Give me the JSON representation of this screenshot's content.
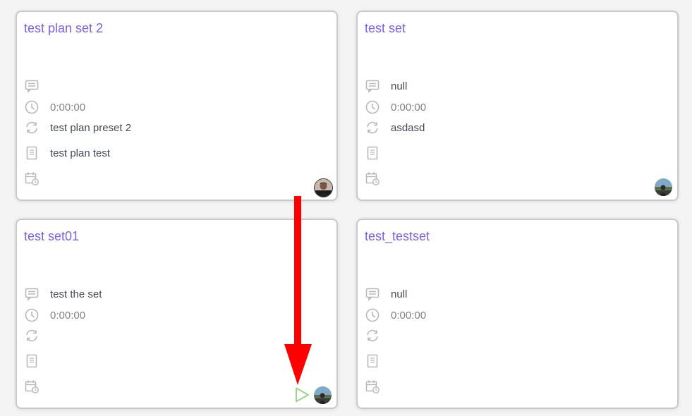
{
  "cards": [
    {
      "title": "test plan set 2",
      "comment": "",
      "duration": "0:00:00",
      "preset": "test plan preset 2",
      "plan": "test plan test",
      "avatar": "avatar-dark",
      "has_play": false
    },
    {
      "title": "test set",
      "comment": "null",
      "duration": "0:00:00",
      "preset": "asdasd",
      "plan": "",
      "avatar": "avatar-landscape",
      "has_play": false
    },
    {
      "title": "test set01",
      "comment": "test the set",
      "duration": "0:00:00",
      "preset": "",
      "plan": "",
      "avatar": "avatar-landscape",
      "has_play": true
    },
    {
      "title": "test_testset",
      "comment": "null",
      "duration": "0:00:00",
      "preset": "",
      "plan": "",
      "avatar": "",
      "has_play": false
    }
  ],
  "icons": {
    "comment": "comment-icon",
    "duration": "clock-icon",
    "preset": "refresh-icon",
    "plan": "document-icon",
    "schedule": "calendar-clock-icon",
    "play": "play-icon"
  },
  "colors": {
    "title": "#7b5fe6",
    "icon": "#b8b8bc",
    "play": "#8fd27a",
    "annotation_arrow": "#ff0000"
  }
}
